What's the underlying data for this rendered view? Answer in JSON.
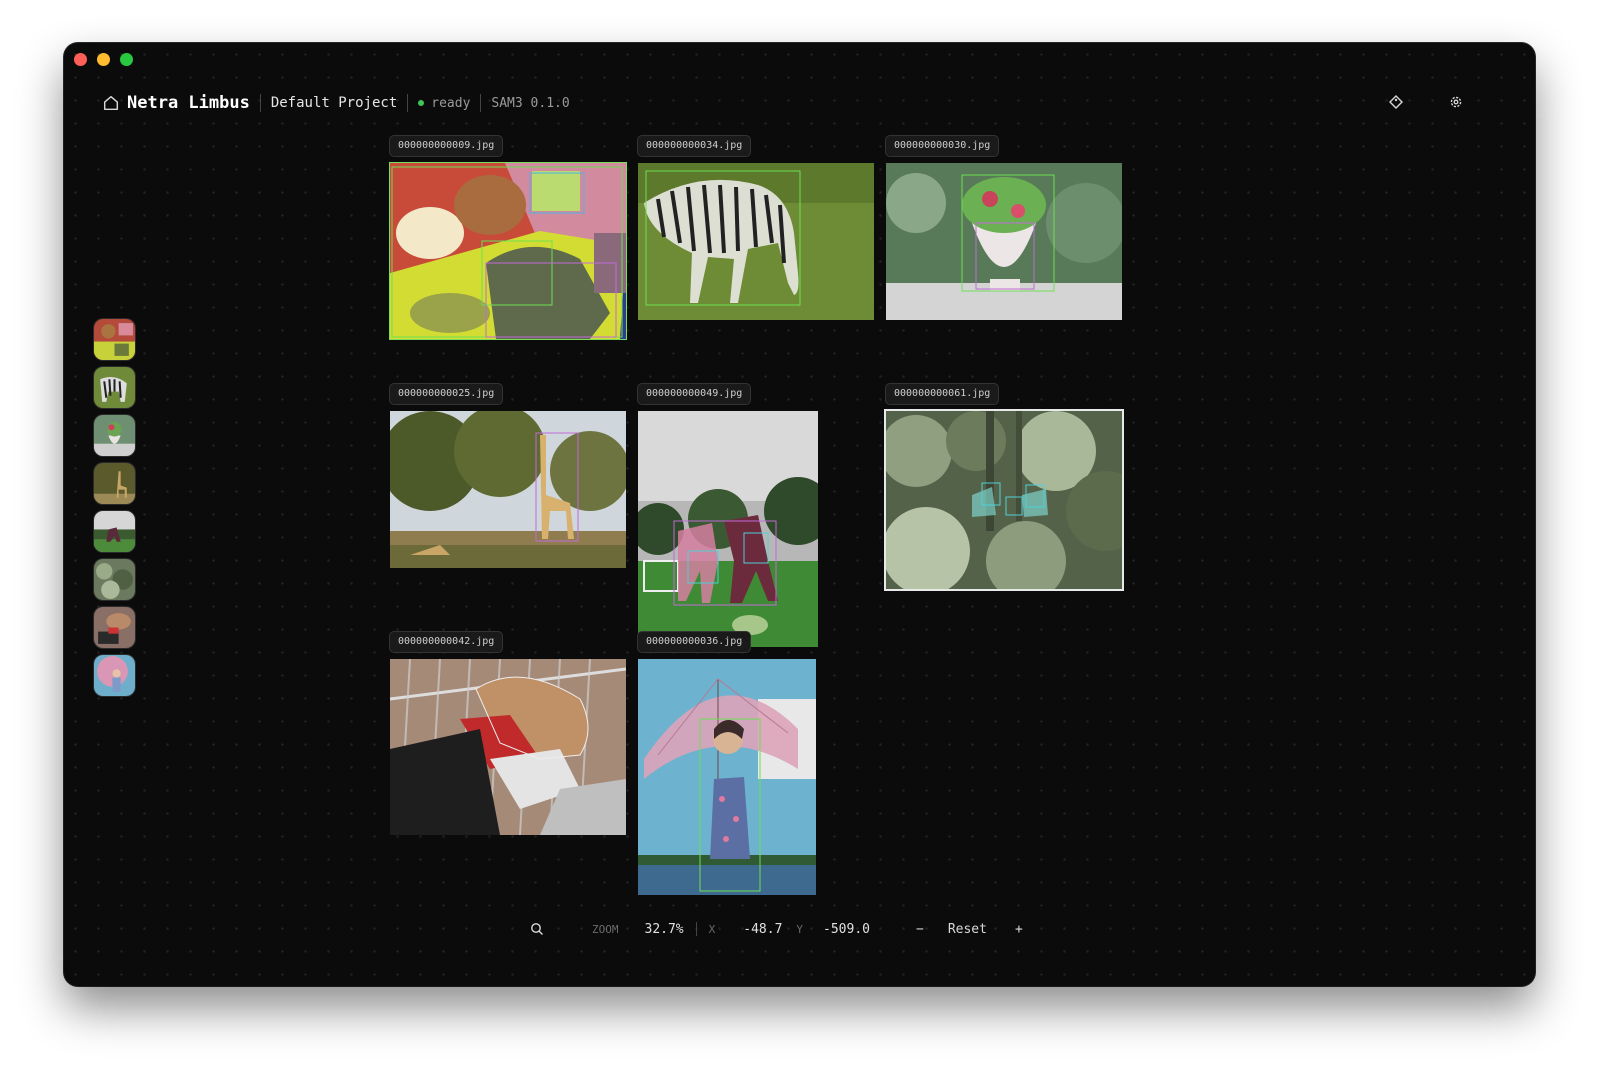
{
  "app": {
    "title": "Netra Limbus",
    "project": "Default Project",
    "status": "ready",
    "model": "SAM3 0.1.0",
    "status_color": "#3dc755"
  },
  "icons": {
    "home": "home-icon",
    "tag": "tag-icon",
    "settings": "gear-icon",
    "search": "search-icon"
  },
  "images": [
    {
      "name": "000000000009.jpg",
      "scene": "food-bento",
      "selected": false
    },
    {
      "name": "000000000034.jpg",
      "scene": "zebra",
      "selected": false
    },
    {
      "name": "000000000030.jpg",
      "scene": "vase",
      "selected": false
    },
    {
      "name": "000000000025.jpg",
      "scene": "giraffe",
      "selected": false
    },
    {
      "name": "000000000049.jpg",
      "scene": "horses",
      "selected": false
    },
    {
      "name": "000000000061.jpg",
      "scene": "jungle",
      "selected": true
    },
    {
      "name": "000000000042.jpg",
      "scene": "dog-shoes",
      "selected": false
    },
    {
      "name": "000000000036.jpg",
      "scene": "umbrella-woman",
      "selected": false
    }
  ],
  "controls": {
    "zoom_label": "ZOOM",
    "zoom_value": "32.7%",
    "x_label": "X",
    "x_value": "-48.7",
    "y_label": "Y",
    "y_value": "-509.0",
    "minus": "−",
    "reset": "Reset",
    "plus": "+"
  }
}
